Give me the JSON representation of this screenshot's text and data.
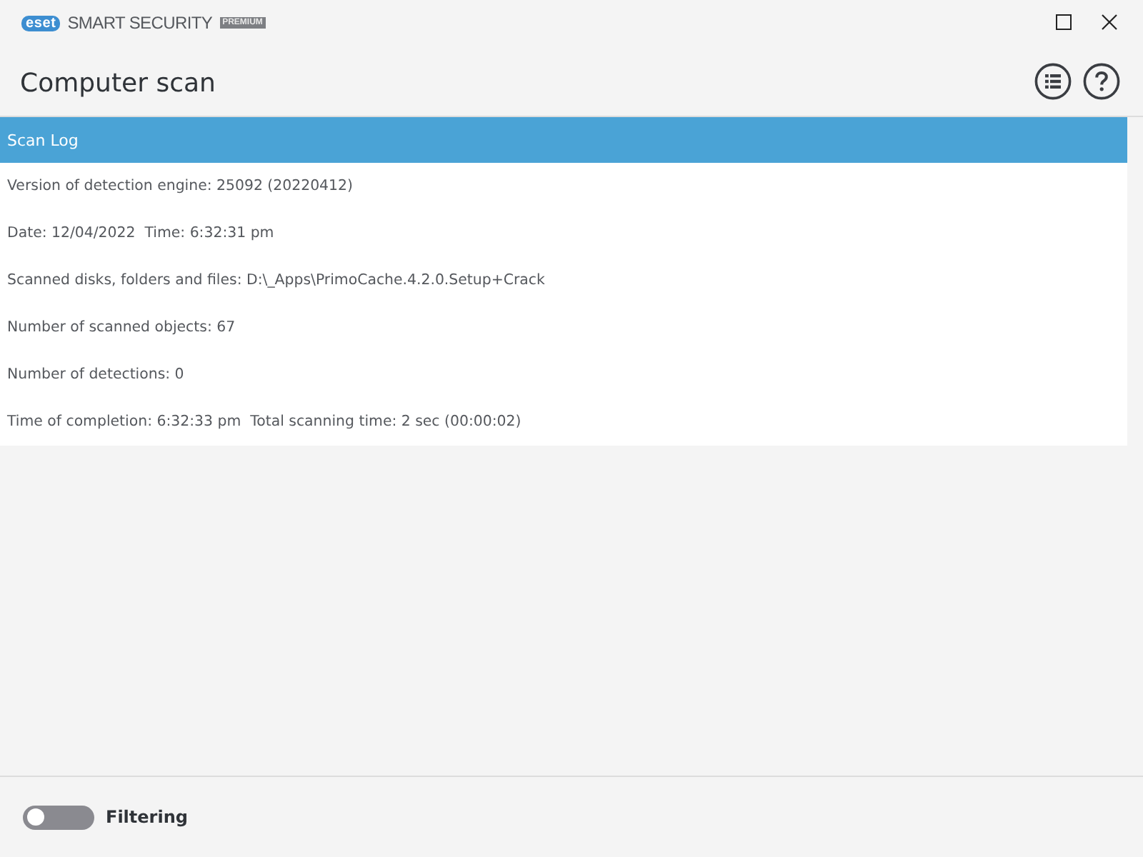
{
  "window": {
    "logo": "eset",
    "product": "SMART SECURITY",
    "edition": "PREMIUM"
  },
  "page": {
    "title": "Computer scan"
  },
  "log": {
    "title": "Scan Log",
    "lines": [
      "Version of detection engine: 25092 (20220412)",
      "Date: 12/04/2022  Time: 6:32:31 pm",
      "Scanned disks, folders and files: D:\\_Apps\\PrimoCache.4.2.0.Setup+Crack",
      "Number of scanned objects: 67",
      "Number of detections: 0",
      "Time of completion: 6:32:33 pm  Total scanning time: 2 sec (00:00:02)"
    ]
  },
  "footer": {
    "toggle": {
      "label": "Filtering",
      "on": false
    }
  }
}
